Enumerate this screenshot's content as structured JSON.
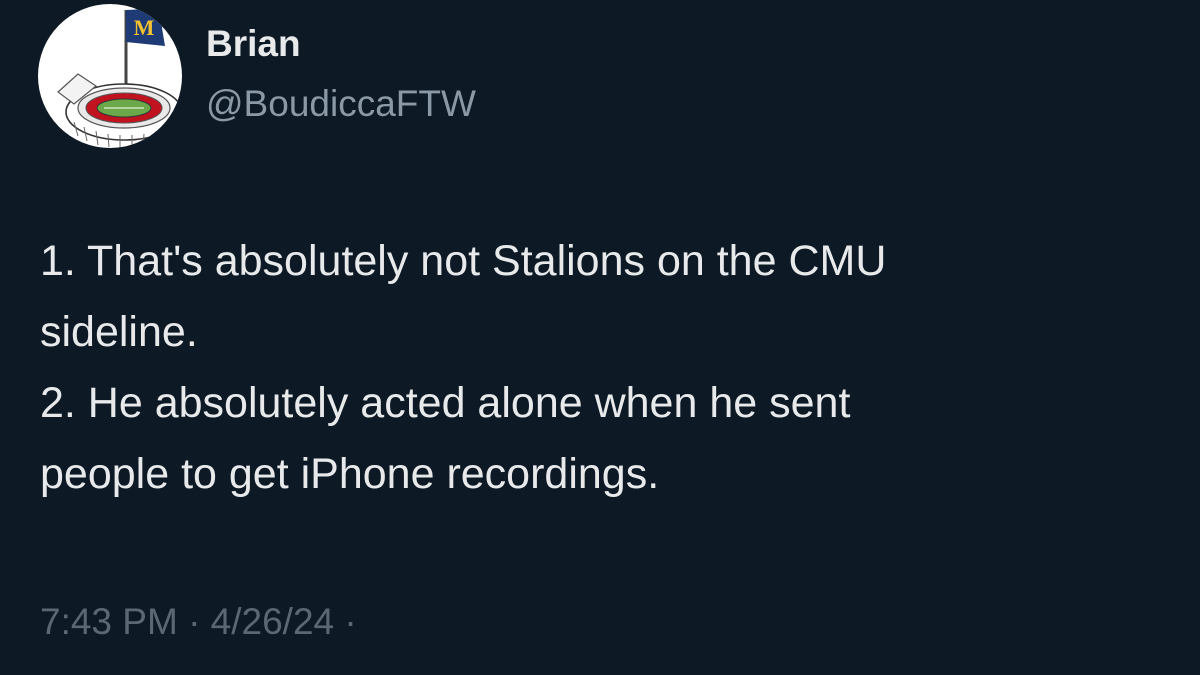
{
  "author": {
    "display_name": "Brian",
    "handle": "@BoudiccaFTW",
    "avatar": {
      "icon": "stadium-flag-avatar-icon",
      "flag_letter": "M",
      "flag_color": "#1f3b75",
      "letter_color": "#f2c230"
    }
  },
  "tweet": {
    "lines": [
      "1. That's absolutely not Stalions on the CMU",
      "sideline.",
      "2. He absolutely acted alone when he sent",
      "people to get iPhone recordings."
    ]
  },
  "meta": {
    "timestamp": "7:43 PM · 4/26/24 ·"
  },
  "colors": {
    "background": "#0d1a26",
    "primary_text": "#e7e9ea",
    "secondary_text": "#8b98a5",
    "meta_text": "#5b6874"
  }
}
